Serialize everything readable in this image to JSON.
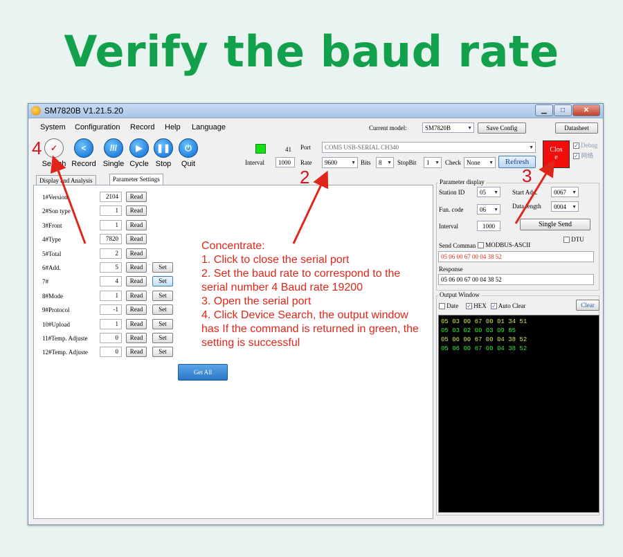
{
  "headline": "Verify the baud rate",
  "window": {
    "title": "SM7820B  V1.21.5.20",
    "minimize": "▁",
    "maximize": "□",
    "close": "✕"
  },
  "menu": [
    "System",
    "Configuration",
    "Record",
    "Help",
    "Language"
  ],
  "current_model": {
    "label": "Current model:",
    "value": "SM7820B",
    "save": "Save Config",
    "datasheet": "Datasheet"
  },
  "toolbar": [
    "Search",
    "Record",
    "Single",
    "Cycle",
    "Stop",
    "Quit"
  ],
  "status": {
    "count": "41",
    "interval_label": "Interval",
    "interval": "1000"
  },
  "port": {
    "label": "Port",
    "value": "COM5 USB-SERIAL CH340"
  },
  "rate": {
    "label": "Rate",
    "value": "9600",
    "bits_label": "Bits",
    "bits": "8",
    "stop_label": "StopBit",
    "stop": "1",
    "check_label": "Check",
    "check": "None",
    "refresh": "Refresh"
  },
  "close_port": "Clos\ne",
  "debug": {
    "debug": "Debug",
    "net": "网络"
  },
  "tabs": [
    "Display and Analysis",
    "Parameter Settings"
  ],
  "params": [
    {
      "name": "1#Version",
      "value": "2104",
      "read": "Read"
    },
    {
      "name": "2#Son type",
      "value": "1",
      "read": "Read"
    },
    {
      "name": "3#Front",
      "value": "1",
      "read": "Read"
    },
    {
      "name": "4#Type",
      "value": "7820",
      "read": "Read"
    },
    {
      "name": "5#Total",
      "value": "2",
      "read": "Read"
    },
    {
      "name": "6#Add.",
      "value": "5",
      "read": "Read",
      "set": "Set"
    },
    {
      "name": "7#",
      "value": "4",
      "read": "Read",
      "set": "Set"
    },
    {
      "name": "8#Mode",
      "value": "1",
      "read": "Read",
      "set": "Set"
    },
    {
      "name": "9#Protocol",
      "value": "-1",
      "read": "Read",
      "set": "Set"
    },
    {
      "name": "10#Upload",
      "value": "1",
      "read": "Read",
      "set": "Set"
    },
    {
      "name": "11#Temp. Adjuste",
      "value": "0",
      "read": "Read",
      "set": "Set"
    },
    {
      "name": "12#Temp. Adjuste",
      "value": "0",
      "read": "Read",
      "set": "Set"
    }
  ],
  "get_all": "Get All",
  "param_display": {
    "title": "Parameter display",
    "station_label": "Station ID",
    "station": "05",
    "start_label": "Start Add.",
    "start": "0067",
    "fun_label": "Fun. code",
    "fun": "06",
    "len_label": "Data length",
    "len": "0004",
    "interval_label": "Interval",
    "interval": "1000",
    "single_send": "Single Send",
    "dtu": "DTU",
    "send_label": "Send Comman",
    "modbus": "MODBUS-ASCII",
    "send_value": "05 06 00 67 00 04 38 52",
    "response_label": "Response",
    "response_value": "05 06 00 67 00 04 38 52"
  },
  "output": {
    "title": "Output Window",
    "date": "Date",
    "hex": "HEX",
    "auto_clear": "Auto Clear",
    "clear": "Clear",
    "lines": [
      "05 03 00 67 00 01 34 51",
      "05 03 02 00 03 09 85",
      "05 06 00 67 00 04 38 52",
      "05 06 00 67 00 04 38 52"
    ]
  },
  "note": {
    "title": "Concentrate:",
    "lines": [
      "1. Click to close the serial port",
      "2. Set the baud rate to correspond to the serial number 4 Baud rate 19200",
      "3. Open the serial port",
      "4. Click Device Search, the output window has If the command is returned in green, the setting is successful"
    ]
  },
  "markers": [
    "4",
    "2",
    "3"
  ],
  "colors": {
    "headline": "#12a04c",
    "annotation": "#e0261a",
    "close_button": "#f20d0d",
    "output_green": "#32e632"
  }
}
